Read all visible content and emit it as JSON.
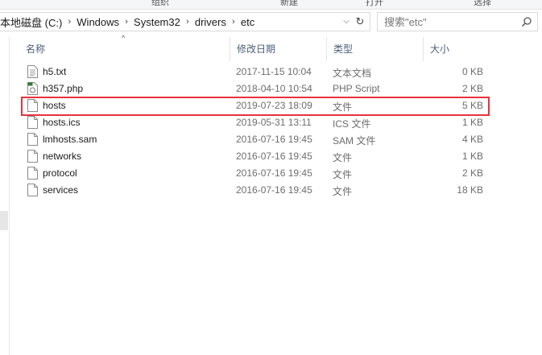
{
  "ribbon": {
    "group1": "组织",
    "group2": "新建",
    "group3": "打开",
    "group4": "选择"
  },
  "address": {
    "crumbs": [
      "本地磁盘 (C:)",
      "Windows",
      "System32",
      "drivers",
      "etc"
    ],
    "separator": "›",
    "dropdown": "⌵",
    "refresh": "↻"
  },
  "search": {
    "placeholder": "搜索\"etc\""
  },
  "columns": {
    "name": "名称",
    "date": "修改日期",
    "type": "类型",
    "size": "大小"
  },
  "files": [
    {
      "name": "h5.txt",
      "date": "2017-11-15 10:04",
      "type": "文本文档",
      "size": "0 KB",
      "icon": "text-file-icon"
    },
    {
      "name": "h357.php",
      "date": "2018-04-10 10:54",
      "type": "PHP Script",
      "size": "2 KB",
      "icon": "php-file-icon"
    },
    {
      "name": "hosts",
      "date": "2019-07-23 18:09",
      "type": "文件",
      "size": "5 KB",
      "icon": "file-icon"
    },
    {
      "name": "hosts.ics",
      "date": "2019-05-31 13:11",
      "type": "ICS 文件",
      "size": "1 KB",
      "icon": "file-icon"
    },
    {
      "name": "lmhosts.sam",
      "date": "2016-07-16 19:45",
      "type": "SAM 文件",
      "size": "4 KB",
      "icon": "file-icon"
    },
    {
      "name": "networks",
      "date": "2016-07-16 19:45",
      "type": "文件",
      "size": "1 KB",
      "icon": "file-icon"
    },
    {
      "name": "protocol",
      "date": "2016-07-16 19:45",
      "type": "文件",
      "size": "2 KB",
      "icon": "file-icon"
    },
    {
      "name": "services",
      "date": "2016-07-16 19:45",
      "type": "文件",
      "size": "18 KB",
      "icon": "file-icon"
    }
  ],
  "colors": {
    "highlight": "#e8323c",
    "header_text": "#4c607a",
    "secondary_text": "#6d6d6d"
  }
}
